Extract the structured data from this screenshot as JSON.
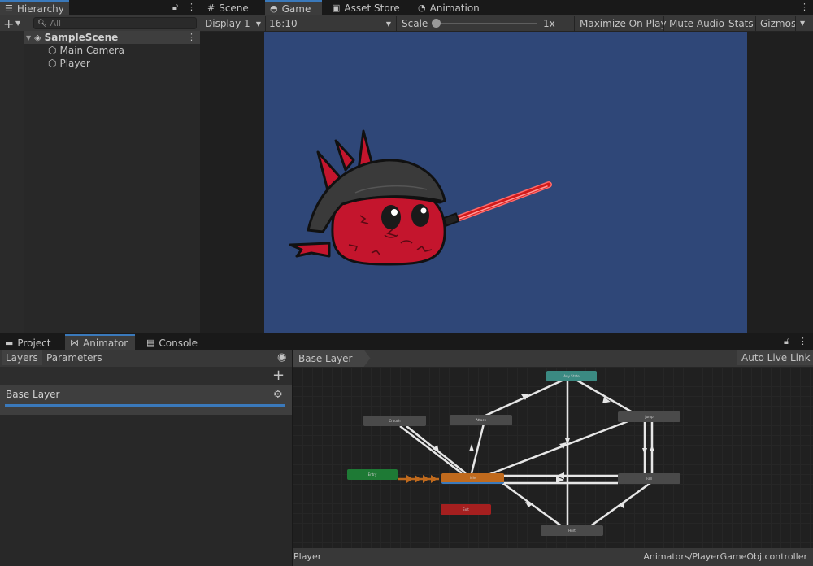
{
  "hierarchy": {
    "tab_label": "Hierarchy",
    "search_placeholder": "All",
    "scene": "SampleScene",
    "items": [
      "Main Camera",
      "Player"
    ]
  },
  "top_tabs": [
    "Scene",
    "Game",
    "Asset Store",
    "Animation"
  ],
  "game_toolbar": {
    "display": "Display 1",
    "aspect": "16:10",
    "scale_label": "Scale",
    "scale_value": "1x",
    "maximize": "Maximize On Play",
    "mute": "Mute Audio",
    "stats": "Stats",
    "gizmos": "Gizmos"
  },
  "bottom_tabs": [
    "Project",
    "Animator",
    "Console"
  ],
  "animator": {
    "left_tabs": [
      "Layers",
      "Parameters"
    ],
    "layer_name": "Base Layer",
    "breadcrumb": "Base Layer",
    "auto_live_link": "Auto Live Link",
    "status_left": "Player",
    "status_right": "Animators/PlayerGameObj.controller",
    "states": {
      "any_state": "Any State",
      "crouch": "Crouch",
      "attack": "Attack",
      "jump": "Jump",
      "entry": "Entry",
      "idle": "Idle",
      "fall": "Fall",
      "exit": "Exit",
      "hurt": "Hurt"
    }
  },
  "colors": {
    "accent_blue": "#3a79bb",
    "game_bg": "#2f4778",
    "state_default": "#4a4a4a",
    "state_entry": "#1e7a35",
    "state_idle": "#c06a1d",
    "state_exit": "#a51f1f",
    "state_any": "#3b8a82"
  }
}
